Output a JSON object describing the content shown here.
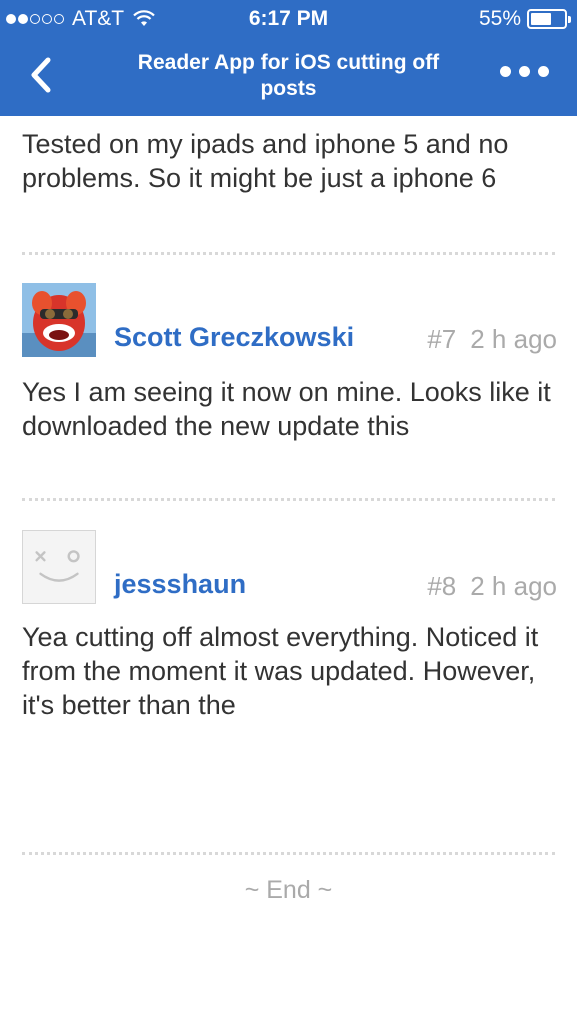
{
  "status_bar": {
    "carrier": "AT&T",
    "time": "6:17 PM",
    "battery": "55%",
    "signal_bars_filled": 2,
    "signal_bars_total": 5,
    "battery_level": 0.55
  },
  "nav": {
    "title": "Reader App for iOS cutting off posts",
    "back_icon": "chevron-left-icon",
    "more_icon": "more-dots-icon"
  },
  "posts": [
    {
      "body": "Tested on my ipads and iphone 5 and no problems. So it might be just a iphone 6"
    },
    {
      "author": "Scott Greczkowski",
      "number": "#7",
      "time": "2 h ago",
      "body": "Yes I am seeing it now on mine.  Looks like it downloaded the new update this"
    },
    {
      "author": "jessshaun",
      "number": "#8",
      "time": "2 h ago",
      "body": "Yea cutting off almost everything. Noticed it from the moment it was updated. However, it's better than the"
    }
  ],
  "footer": {
    "end_label": "~ End ~"
  },
  "colors": {
    "accent": "#2f6dc5",
    "meta_gray": "#aaaaaa"
  }
}
